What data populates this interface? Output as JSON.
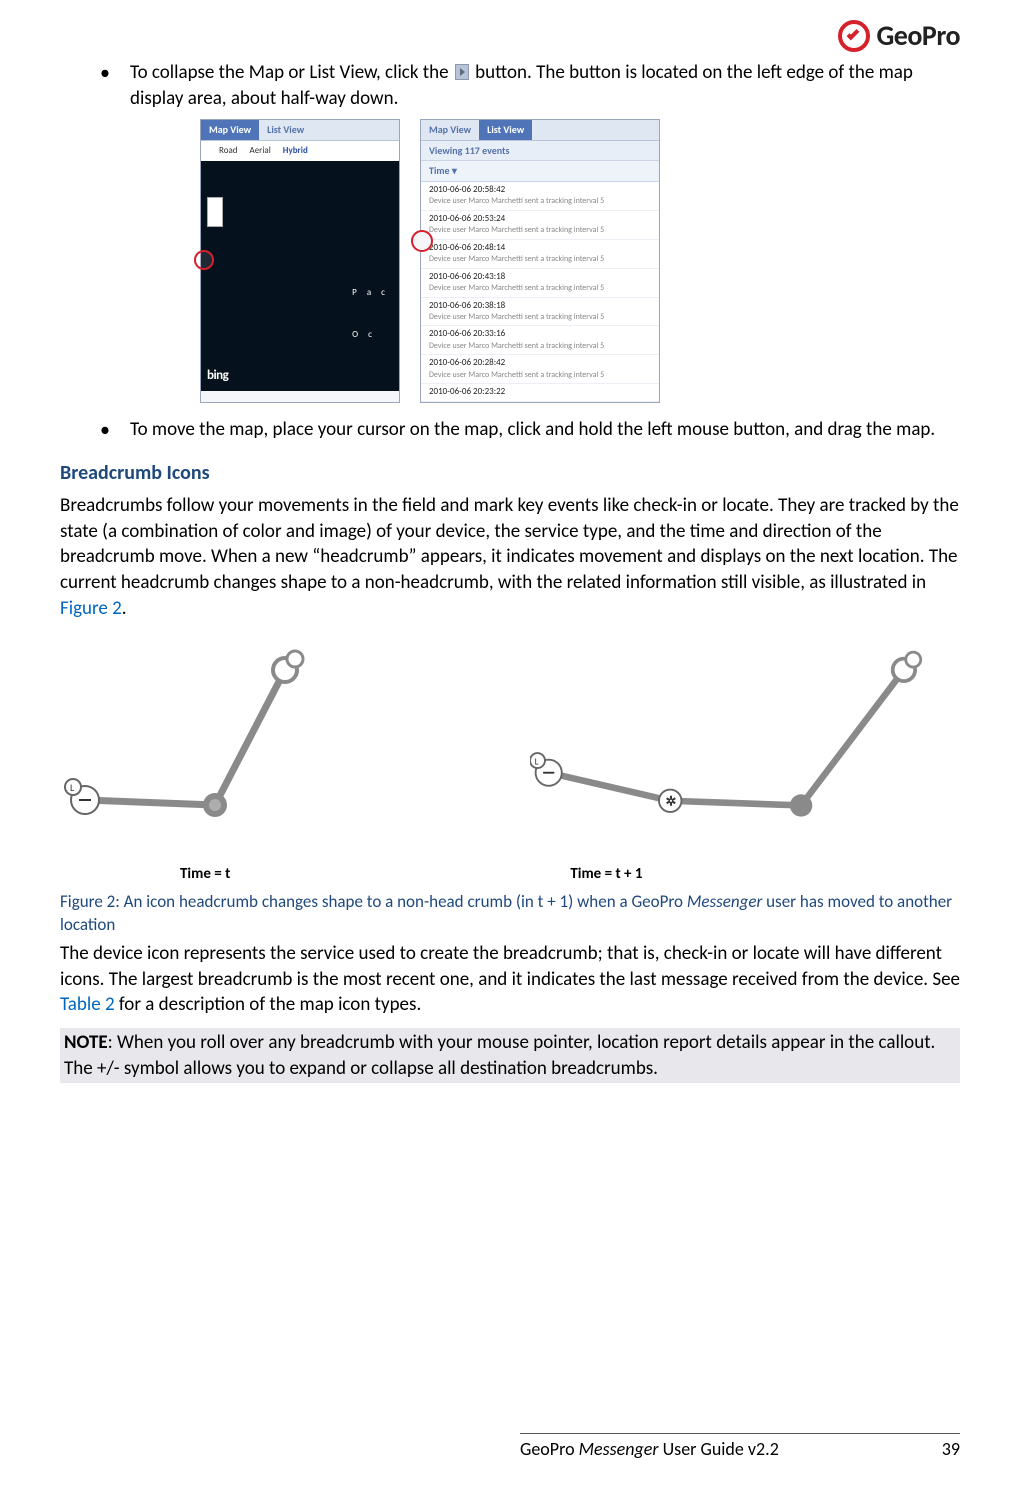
{
  "header": {
    "brand": "GeoPro"
  },
  "bullets": {
    "b1a": "To collapse the Map or List View, click the ",
    "b1b": " button. The button is located on the left edge of the map display area, about half-way down.",
    "b2": "To move the map, place your cursor on the map, click and hold the left mouse button, and drag the map."
  },
  "shot_a": {
    "tab_map": "Map View",
    "tab_list": "List View",
    "ctrl_road": "Road",
    "ctrl_aerial": "Aerial",
    "ctrl_hybrid": "Hybrid",
    "bing": "bing",
    "letters1": "P   a   c",
    "letters2": "O   c"
  },
  "shot_b": {
    "tab_map": "Map View",
    "tab_list": "List View",
    "viewing": "Viewing 117 events",
    "time_label": "Time ▾",
    "rows": [
      {
        "t": "2010-06-06 20:58:42",
        "d": "Device user Marco Marchetti sent a tracking interval 5"
      },
      {
        "t": "2010-06-06 20:53:24",
        "d": "Device user Marco Marchetti sent a tracking interval 5"
      },
      {
        "t": "2010-06-06 20:48:14",
        "d": "Device user Marco Marchetti sent a tracking interval 5"
      },
      {
        "t": "2010-06-06 20:43:18",
        "d": "Device user Marco Marchetti sent a tracking interval 5"
      },
      {
        "t": "2010-06-06 20:38:18",
        "d": "Device user Marco Marchetti sent a tracking interval 5"
      },
      {
        "t": "2010-06-06 20:33:16",
        "d": "Device user Marco Marchetti sent a tracking interval 5"
      },
      {
        "t": "2010-06-06 20:28:42",
        "d": "Device user Marco Marchetti sent a tracking interval 5"
      },
      {
        "t": "2010-06-06 20:23:22",
        "d": ""
      }
    ]
  },
  "section": {
    "heading": "Breadcrumb Icons",
    "p1a": "Breadcrumbs follow your movements in the field and mark key events like check-in or locate. They are tracked by the state (a combination of color and image) of your device, the service type, and the time and direction of the breadcrumb move. When a new “headcrumb” appears, it indicates movement and displays on the next location. The current headcrumb changes shape to a non-headcrumb, with the related information still visible, as illustrated in ",
    "p1_link": "Figure 2",
    "p1b": "."
  },
  "figure": {
    "cap_t": "Time = t",
    "cap_t1": "Time = t + 1",
    "caption_a": "Figure 2: An icon headcrumb changes shape to a non-head crumb (in t + 1) when a GeoPro ",
    "caption_em": "Messenger",
    "caption_b": " user has moved to another location"
  },
  "para2": {
    "a": "The device icon represents the service used to create the breadcrumb; that is, check-in or locate will have different icons. The largest breadcrumb is the most recent one, and it indicates the last message received from the device. See ",
    "link": "Table 2",
    "b": " for a description of the map icon types."
  },
  "note": {
    "label": "NOTE",
    "text": ": When you roll over any breadcrumb with your mouse pointer, location report details appear in the callout. The +/- symbol allows you to expand or collapse all destination breadcrumbs."
  },
  "footer": {
    "title_a": "GeoPro ",
    "title_em": "Messenger",
    "title_b": " User Guide v2.2",
    "page": "39"
  }
}
